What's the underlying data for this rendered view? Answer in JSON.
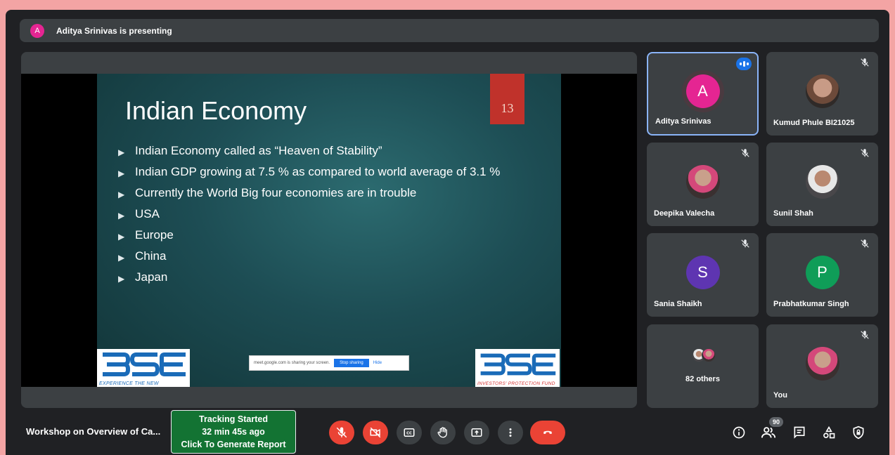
{
  "presenter_banner": {
    "avatar_letter": "A",
    "text": "Aditya Srinivas is presenting"
  },
  "slide": {
    "title": "Indian Economy",
    "number": "13",
    "bullets": [
      "Indian Economy called as “Heaven of Stability”",
      "Indian GDP growing at 7.5 % as compared to world average of 3.1 %",
      "Currently the World Big four economies are in trouble",
      "USA",
      "Europe",
      "China",
      "Japan"
    ],
    "logo_left_tagline": "EXPERIENCE THE NEW",
    "logo_right_tagline": "INVESTORS' PROTECTION FUND",
    "share_notice": {
      "text": "meet.google.com is sharing your screen.",
      "stop": "Stop sharing",
      "hide": "Hide"
    }
  },
  "participants": [
    {
      "name": "Aditya Srinivas",
      "avatar_letter": "A",
      "avatar_color": "#e52592",
      "speaking": true
    },
    {
      "name": "Kumud Phule BI21025",
      "muted": true
    },
    {
      "name": "Deepika Valecha",
      "muted": true
    },
    {
      "name": "Sunil Shah",
      "muted": true
    },
    {
      "name": "Sania Shaikh",
      "avatar_letter": "S",
      "avatar_color": "#5e35b1",
      "muted": true
    },
    {
      "name": "Prabhatkumar Singh",
      "avatar_letter": "P",
      "avatar_color": "#0f9d58",
      "muted": true
    },
    {
      "name": "82 others"
    },
    {
      "name": "You",
      "muted": true
    }
  ],
  "bottom_bar": {
    "meeting_title": "Workshop on Overview of Ca...",
    "tracking": {
      "line1": "Tracking Started",
      "line2": "32 min 45s ago",
      "line3": "Click To Generate Report"
    },
    "participant_count": "90"
  },
  "colors": {
    "end_call": "#ea4335",
    "tracking_bg": "#137333",
    "active_border": "#8ab4f8"
  }
}
